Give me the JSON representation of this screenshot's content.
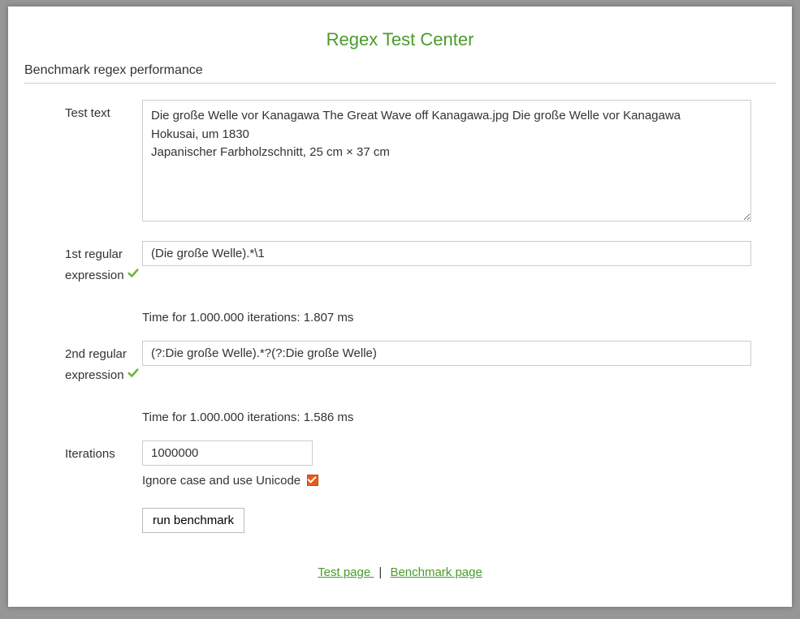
{
  "header": {
    "title": "Regex Test Center",
    "subtitle": "Benchmark regex performance"
  },
  "form": {
    "test_text": {
      "label": "Test text",
      "value": "Die große Welle vor Kanagawa The Great Wave off Kanagawa.jpg Die große Welle vor Kanagawa\nHokusai, um 1830\nJapanischer Farbholzschnitt, 25 cm × 37 cm"
    },
    "regex1": {
      "label": "1st regular expression",
      "value": "(Die große Welle).*\\1",
      "valid": true,
      "result": "Time for 1.000.000 iterations: 1.807 ms"
    },
    "regex2": {
      "label": "2nd regular expression",
      "value": "(?:Die große Welle).*?(?:Die große Welle)",
      "valid": true,
      "result": "Time for 1.000.000 iterations: 1.586 ms"
    },
    "iterations": {
      "label": "Iterations",
      "value": "1000000",
      "checkbox_label": "Ignore case and use Unicode",
      "checkbox_checked": true
    },
    "run_button": "run benchmark"
  },
  "footer": {
    "test_page": "Test page ",
    "benchmark_page": "Benchmark page",
    "separator": "|"
  }
}
